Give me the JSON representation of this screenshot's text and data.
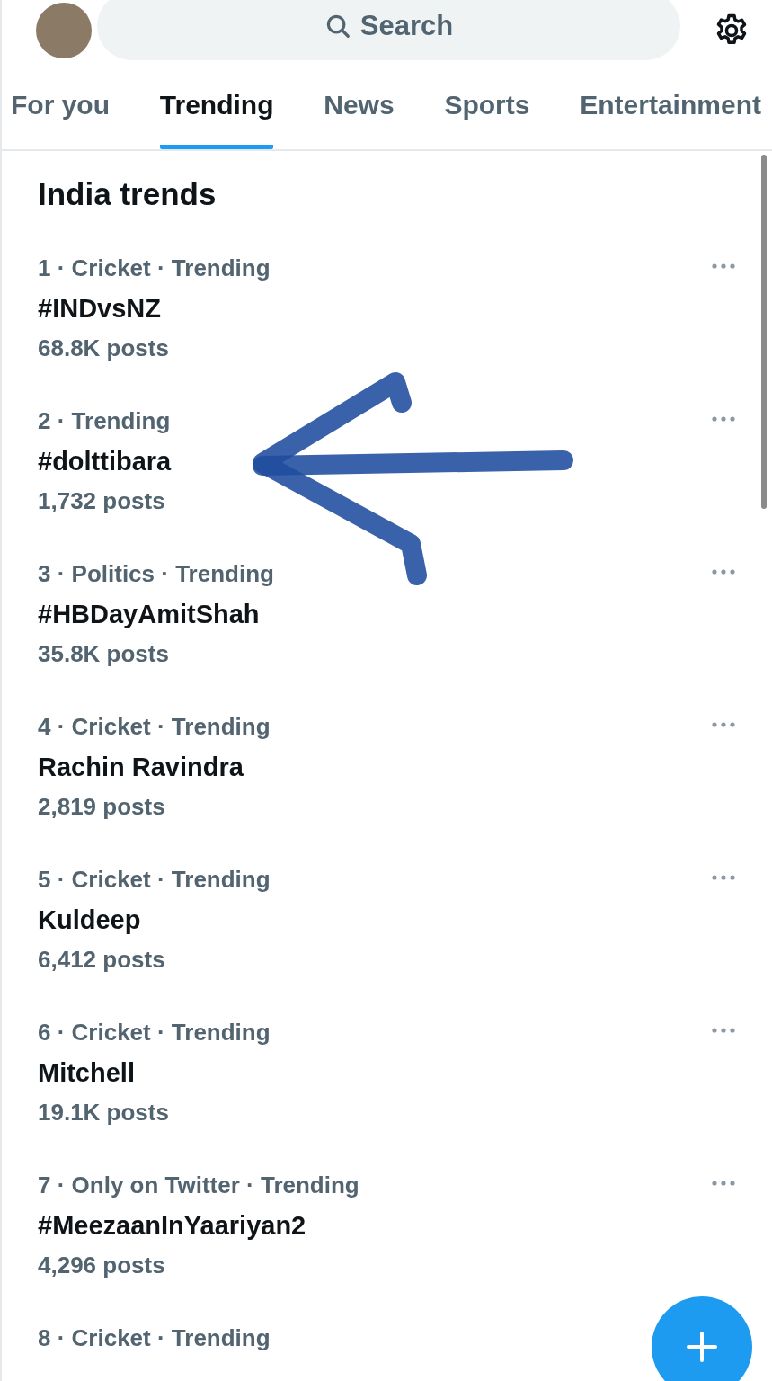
{
  "search": {
    "placeholder": "Search"
  },
  "tabs": [
    {
      "label": "For you",
      "selected": false
    },
    {
      "label": "Trending",
      "selected": true
    },
    {
      "label": "News",
      "selected": false
    },
    {
      "label": "Sports",
      "selected": false
    },
    {
      "label": "Entertainment",
      "selected": false
    }
  ],
  "section_title": "India trends",
  "trends": [
    {
      "meta": "1 · Cricket · Trending",
      "name": "#INDvsNZ",
      "posts": "68.8K posts"
    },
    {
      "meta": "2 · Trending",
      "name": "#dolttibara",
      "posts": "1,732 posts"
    },
    {
      "meta": "3 · Politics · Trending",
      "name": "#HBDayAmitShah",
      "posts": "35.8K posts"
    },
    {
      "meta": "4 · Cricket · Trending",
      "name": "Rachin Ravindra",
      "posts": "2,819 posts"
    },
    {
      "meta": "5 · Cricket · Trending",
      "name": "Kuldeep",
      "posts": "6,412 posts"
    },
    {
      "meta": "6 · Cricket · Trending",
      "name": "Mitchell",
      "posts": "19.1K posts"
    },
    {
      "meta": "7 · Only on Twitter · Trending",
      "name": "#MeezaanInYaariyan2",
      "posts": "4,296 posts"
    },
    {
      "meta": "8 · Cricket · Trending"
    }
  ]
}
